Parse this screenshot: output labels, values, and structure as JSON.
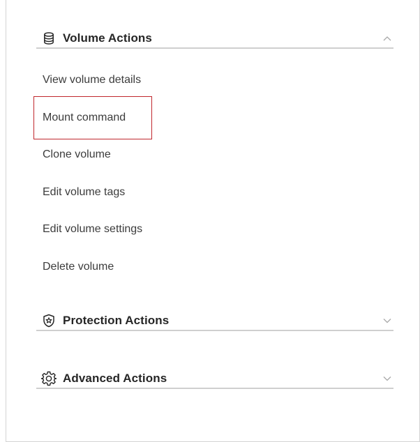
{
  "volume_actions": {
    "title": "Volume Actions",
    "icon": "database-icon",
    "expanded": true,
    "items": [
      "View volume details",
      "Mount command",
      "Clone volume",
      "Edit volume tags",
      "Edit volume settings",
      "Delete volume"
    ],
    "highlighted_item": "Mount command",
    "highlight_color": "#c0272d"
  },
  "protection_actions": {
    "title": "Protection Actions",
    "icon": "shield-star-icon",
    "expanded": false
  },
  "advanced_actions": {
    "title": "Advanced Actions",
    "icon": "gear-icon",
    "expanded": false
  },
  "colors": {
    "heading_text": "#262626",
    "item_text": "#3c3c3c",
    "divider": "#cfcfcf",
    "chevron": "#a8a8a8"
  }
}
